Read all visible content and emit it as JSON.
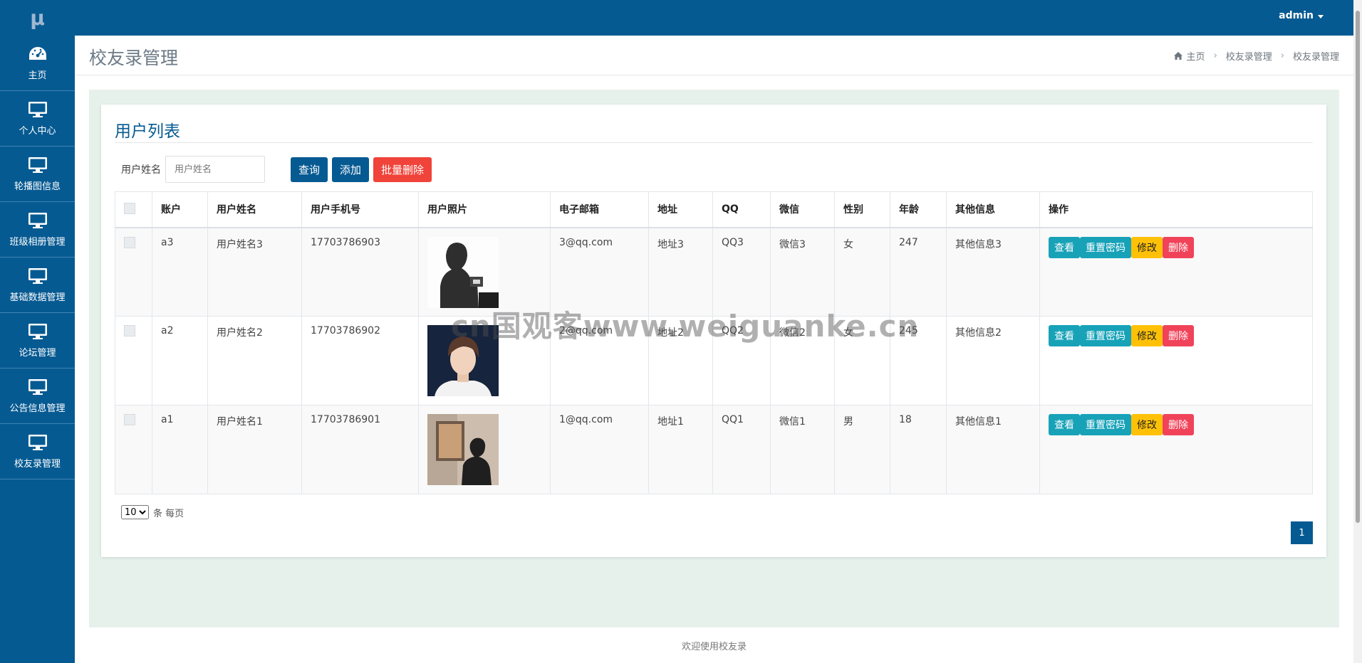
{
  "topbar": {
    "user": "admin"
  },
  "sidebar": {
    "logo": "μ",
    "items": [
      {
        "label": "主页",
        "icon": "dashboard-icon"
      },
      {
        "label": "个人中心",
        "icon": "monitor-icon"
      },
      {
        "label": "轮播图信息",
        "icon": "monitor-icon"
      },
      {
        "label": "班级相册管理",
        "icon": "monitor-icon"
      },
      {
        "label": "基础数据管理",
        "icon": "monitor-icon"
      },
      {
        "label": "论坛管理",
        "icon": "monitor-icon"
      },
      {
        "label": "公告信息管理",
        "icon": "monitor-icon"
      },
      {
        "label": "校友录管理",
        "icon": "monitor-icon"
      }
    ]
  },
  "header": {
    "title": "校友录管理",
    "breadcrumb": [
      "主页",
      "校友录管理",
      "校友录管理"
    ]
  },
  "panel": {
    "title": "用户列表",
    "search": {
      "label": "用户姓名",
      "placeholder": "用户姓名",
      "value": ""
    },
    "buttons": {
      "query": "查询",
      "add": "添加",
      "batch_delete": "批量删除"
    }
  },
  "table": {
    "headers": [
      "账户",
      "用户姓名",
      "用户手机号",
      "用户照片",
      "电子邮箱",
      "地址",
      "QQ",
      "微信",
      "性别",
      "年龄",
      "其他信息",
      "操作"
    ],
    "rows": [
      {
        "account": "a3",
        "name": "用户姓名3",
        "phone": "17703786903",
        "photo": "photo-3",
        "email": "3@qq.com",
        "address": "地址3",
        "qq": "QQ3",
        "wechat": "微信3",
        "gender": "女",
        "age": "247",
        "other": "其他信息3"
      },
      {
        "account": "a2",
        "name": "用户姓名2",
        "phone": "17703786902",
        "photo": "photo-2",
        "email": "2@qq.com",
        "address": "地址2",
        "qq": "QQ2",
        "wechat": "微信2",
        "gender": "女",
        "age": "245",
        "other": "其他信息2"
      },
      {
        "account": "a1",
        "name": "用户姓名1",
        "phone": "17703786901",
        "photo": "photo-1",
        "email": "1@qq.com",
        "address": "地址1",
        "qq": "QQ1",
        "wechat": "微信1",
        "gender": "男",
        "age": "18",
        "other": "其他信息1"
      }
    ],
    "actions": {
      "view": "查看",
      "reset": "重置密码",
      "edit": "修改",
      "delete": "删除"
    }
  },
  "pagination": {
    "page_size": "10",
    "page_size_suffix": "条 每页",
    "current_page": "1"
  },
  "footer": {
    "text": "欢迎使用校友录"
  },
  "watermark": "cn国观客www.weiguanke.cn",
  "colors": {
    "primary": "#065a92",
    "danger": "#f0433a",
    "info": "#17a2b8",
    "warning": "#ffc107"
  }
}
